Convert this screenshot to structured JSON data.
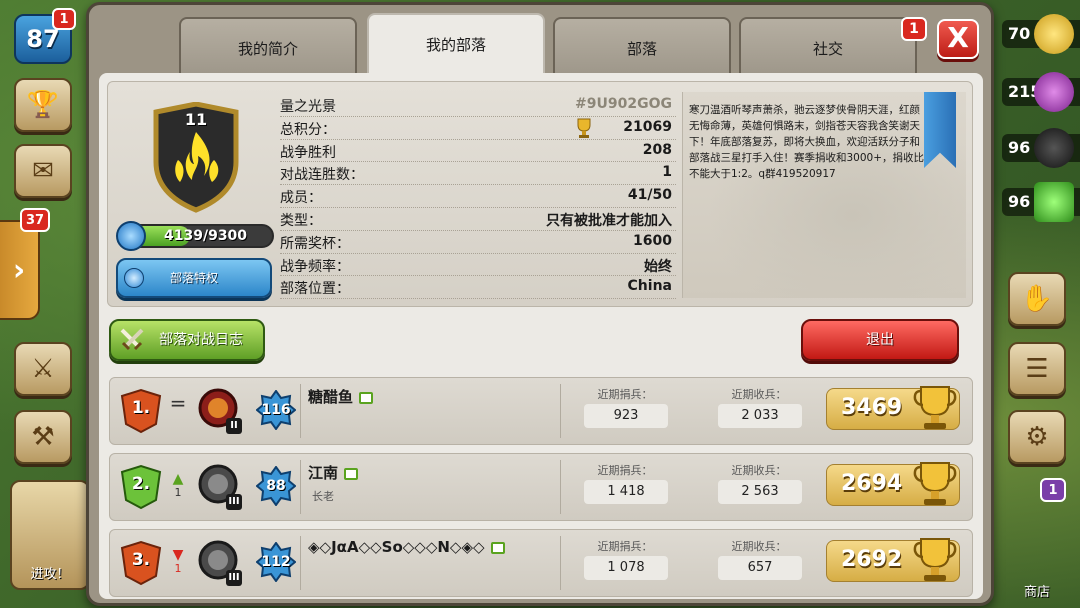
{
  "background": {
    "player_level": "87",
    "player_level_badge": "1",
    "side_tab_badge": "37",
    "left_bottom_label": "进攻！",
    "right_bottom_label": "商店",
    "right_bottom_badge": "1",
    "resources": [
      "70",
      "215",
      "96",
      "96"
    ]
  },
  "tabs": [
    {
      "label": "我的简介",
      "active": false
    },
    {
      "label": "我的部落",
      "active": true
    },
    {
      "label": "部落",
      "active": false
    },
    {
      "label": "社交",
      "active": false,
      "badge": "1"
    }
  ],
  "close_label": "X",
  "clan": {
    "name": "量之光景",
    "tag": "#9U902GOG",
    "level": "11",
    "xp_text": "4139/9300",
    "xp_fraction": 0.445,
    "perks_label": "部落特权",
    "stats": [
      {
        "key": "总积分：",
        "value": "21069",
        "trophy": true
      },
      {
        "key": "战争胜利",
        "value": "208"
      },
      {
        "key": "对战连胜数：",
        "value": "1"
      },
      {
        "key": "成员：",
        "value": "41/50"
      },
      {
        "key": "类型：",
        "value": "只有被批准才能加入"
      },
      {
        "key": "所需奖杯：",
        "value": "1600"
      },
      {
        "key": "战争频率：",
        "value": "始终"
      },
      {
        "key": "部落位置：",
        "value": "China"
      }
    ],
    "description": "寒刀温酒听琴声萧杀，驰云逐梦侠骨阴天涯，红颜无悔命薄，英雄何惧路末，剑指苍天容我含笑谢天下！年底部落复苏，即将大换血，欢迎活跃分子和部落战三星打手入住！赛季捐收和3000+，捐收比不能大于1:2。q群419520917"
  },
  "buttons": {
    "war_log": "部落对战日志",
    "leave": "退出"
  },
  "members": [
    {
      "rank": "1.",
      "trend": "=",
      "trend_num": "",
      "league_num": "II",
      "level": "116",
      "name": "糖醋鱼",
      "role": "",
      "donated_label": "近期捐兵：",
      "donated": "923",
      "received_label": "近期收兵：",
      "received": "2 033",
      "trophies": "3469"
    },
    {
      "rank": "2.",
      "trend": "▲",
      "trend_num": "1",
      "league_num": "III",
      "level": "88",
      "name": "江南",
      "role": "长老",
      "donated_label": "近期捐兵：",
      "donated": "1 418",
      "received_label": "近期收兵：",
      "received": "2 563",
      "trophies": "2694"
    },
    {
      "rank": "3.",
      "trend": "▼",
      "trend_num": "1",
      "league_num": "III",
      "level": "112",
      "name": "◈◇JαA◇◇So◇◇◇N◇◈◇",
      "role": "",
      "donated_label": "近期捐兵：",
      "donated": "1 078",
      "received_label": "近期收兵：",
      "received": "657",
      "trophies": "2692"
    }
  ],
  "colors": {
    "tab_active": "#eceae5",
    "close_red": "#d9281f",
    "war_log_green": "#5f9f26",
    "leave_red": "#c21914",
    "trophy_gold": "#d6ad45"
  }
}
